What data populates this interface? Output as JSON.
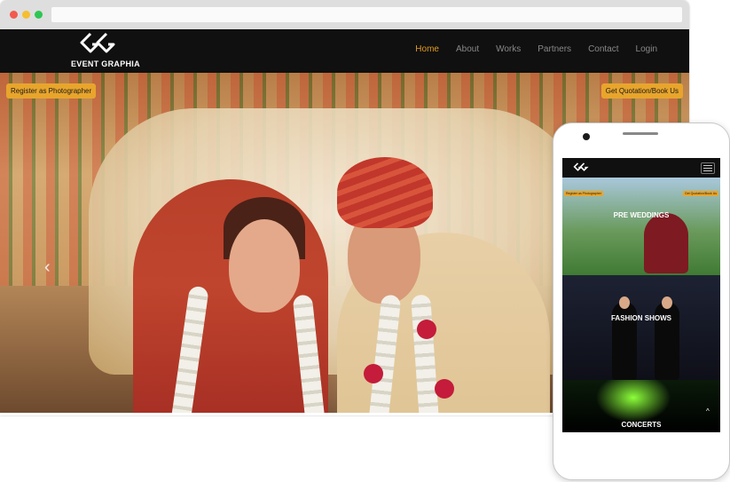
{
  "site": {
    "logo_text": "EVENT GRAPHIA",
    "nav": [
      {
        "label": "Home",
        "active": true
      },
      {
        "label": "About"
      },
      {
        "label": "Works"
      },
      {
        "label": "Partners"
      },
      {
        "label": "Contact"
      },
      {
        "label": "Login"
      }
    ],
    "hero": {
      "left_button": "Register as Photographer",
      "right_button": "Get Quotation/Book Us",
      "prev_arrow": "chevron-left-icon"
    }
  },
  "mobile": {
    "left_button": "Register as Photographer",
    "right_button": "Get Quotation/Book Us",
    "panels": [
      {
        "title": "PRE WEDDINGS"
      },
      {
        "title": "FASHION SHOWS"
      },
      {
        "title": "CONCERTS"
      }
    ]
  },
  "colors": {
    "accent": "#e29a23",
    "button": "#e8a52c",
    "navbar": "#101010"
  }
}
